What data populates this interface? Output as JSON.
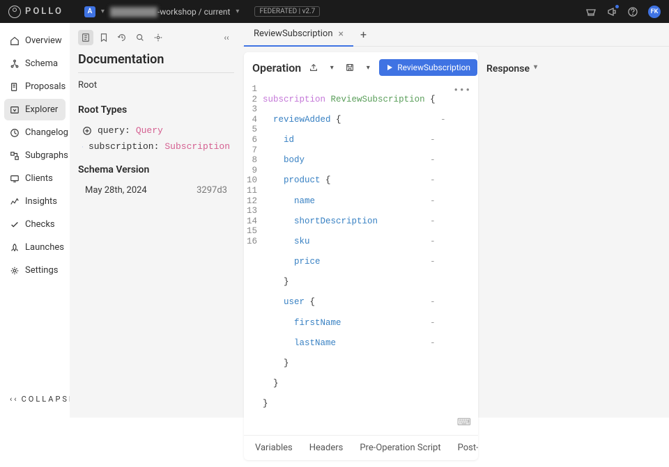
{
  "topbar": {
    "logo_text": "POLLO",
    "badge": "A",
    "breadcrumb_blurred": "████████",
    "breadcrumb_suffix": "-workshop / current",
    "federation_badge": "FEDERATED | v2.7",
    "avatar_initials": "FK"
  },
  "sidebar": {
    "items": [
      {
        "label": "Overview"
      },
      {
        "label": "Schema"
      },
      {
        "label": "Proposals"
      },
      {
        "label": "Explorer"
      },
      {
        "label": "Changelog"
      },
      {
        "label": "Subgraphs"
      },
      {
        "label": "Clients"
      },
      {
        "label": "Insights"
      },
      {
        "label": "Checks"
      },
      {
        "label": "Launches"
      },
      {
        "label": "Settings"
      }
    ],
    "collapse_label": "COLLAPSE"
  },
  "doc": {
    "title": "Documentation",
    "root_label": "Root",
    "root_types_heading": "Root Types",
    "query_label": "query: ",
    "query_type": "Query",
    "subscription_label": "subscription: ",
    "subscription_type": "Subscription",
    "schema_version_heading": "Schema Version",
    "version_date": "May 28th, 2024",
    "version_hash": "3297d3"
  },
  "tabs": {
    "active": "ReviewSubscription"
  },
  "operation": {
    "title": "Operation",
    "run_label": "ReviewSubscription",
    "code": {
      "line1_kw": "subscription",
      "line1_name": "ReviewSubscription",
      "line1_brace": " {",
      "l2": "reviewAdded",
      "l3": "id",
      "l4": "body",
      "l5": "product",
      "l6": "name",
      "l7": "shortDescription",
      "l8": "sku",
      "l9": "price",
      "l11": "user",
      "l12": "firstName",
      "l13": "lastName"
    }
  },
  "bottom_tabs": [
    "Variables",
    "Headers",
    "Pre-Operation Script",
    "Post-Operation S"
  ],
  "response": {
    "title": "Response"
  }
}
